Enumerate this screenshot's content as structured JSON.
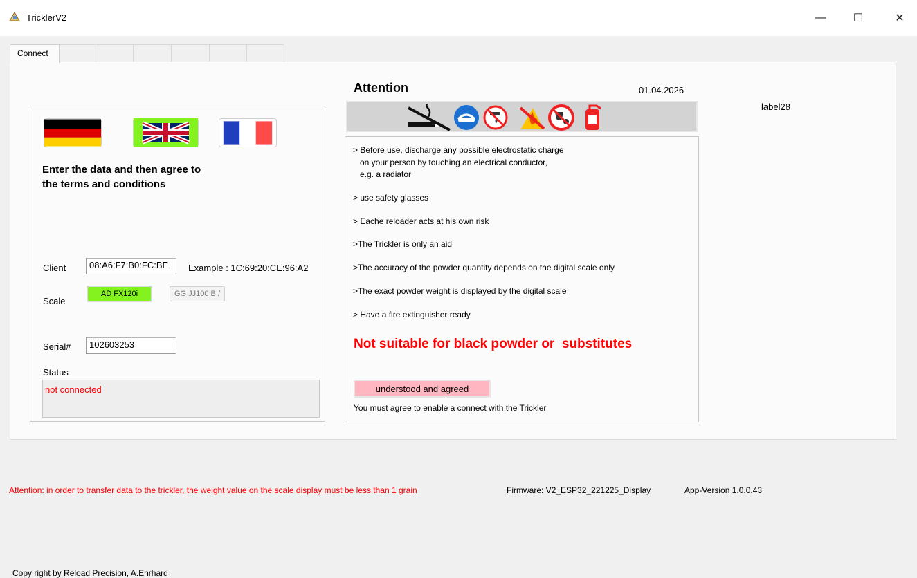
{
  "window": {
    "title": "TricklerV2",
    "minimize_glyph": "—",
    "maximize_glyph": "☐",
    "close_glyph": "✕"
  },
  "tabs": [
    {
      "label": "Connect"
    },
    {
      "label": ""
    },
    {
      "label": ""
    },
    {
      "label": ""
    },
    {
      "label": ""
    },
    {
      "label": ""
    },
    {
      "label": ""
    }
  ],
  "left_panel": {
    "flags": [
      "german-flag",
      "uk-flag",
      "french-flag"
    ],
    "instruction_line1": "Enter the data and then agree to",
    "instruction_line2": "the terms and conditions",
    "client_label": "Client",
    "client_value": "08:A6:F7:B0:FC:BE",
    "client_example": "Example :  1C:69:20:CE:96:A2",
    "scale_label": "Scale",
    "scale_option_selected": "AD FX120i",
    "scale_option_other": "GG JJ100 B /",
    "serial_label": "Serial#",
    "serial_value": "102603253",
    "status_label": "Status",
    "status_value": "not connected"
  },
  "attention": {
    "title": "Attention",
    "date": "01.04.2026",
    "icons": [
      "no-smoking-icon",
      "eye-protection-icon",
      "no-water-icon",
      "no-open-flame-icon",
      "no-food-drink-icon",
      "fire-extinguisher-icon"
    ],
    "notes": {
      "n1_line1": "> Before use, discharge any possible electrostatic charge",
      "n1_line2": "   on your person by touching an electrical conductor,",
      "n1_line3": "   e.g. a radiator",
      "n2": "> use safety glasses",
      "n3": "> Eache reloader acts at his own risk",
      "n4": ">The Trickler is only an aid",
      "n5": ">The accuracy of the powder quantity depends on the digital scale only",
      "n6": ">The exact powder weight is displayed by the digital scale",
      "n7": "> Have a fire extinguisher ready"
    },
    "black_powder_warning": "Not suitable for black powder or  substitutes",
    "agree_button": "understood and agreed",
    "agree_hint": "You must agree to enable a connect with the Trickler"
  },
  "label28": "label28",
  "footer": {
    "transfer_warning": "Attention: in order to transfer data to the trickler, the weight value on the scale display must be less than 1 grain",
    "firmware": "Firmware:  V2_ESP32_221225_Display",
    "app_version": "App-Version 1.0.0.43",
    "copyright": "Copy right by Reload Precision, A.Ehrhard"
  },
  "colors": {
    "scale_selected": "#84f21f",
    "agree_button": "#ffb6c1",
    "warning_red": "#ff0000"
  }
}
